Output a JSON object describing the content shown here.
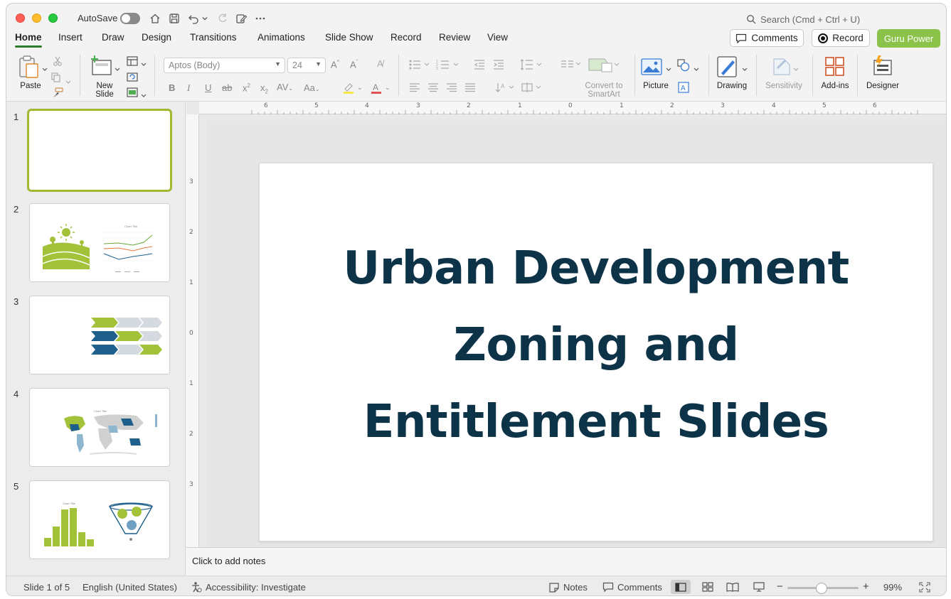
{
  "titlebar": {
    "autosave_label": "AutoSave",
    "search_placeholder": "Search (Cmd + Ctrl + U)"
  },
  "tabs": [
    "Home",
    "Insert",
    "Draw",
    "Design",
    "Transitions",
    "Animations",
    "Slide Show",
    "Record",
    "Review",
    "View"
  ],
  "header_buttons": {
    "comments": "Comments",
    "record": "Record",
    "guru": "Guru Power"
  },
  "ribbon": {
    "paste": "Paste",
    "new_slide": "New\nSlide",
    "font_name": "Aptos (Body)",
    "font_size": "24",
    "convert_smartart": "Convert to\nSmartArt",
    "picture": "Picture",
    "drawing": "Drawing",
    "sensitivity": "Sensitivity",
    "addins": "Add-ins",
    "designer": "Designer"
  },
  "slides": [
    {
      "number": "1"
    },
    {
      "number": "2",
      "thumb_chart_title": "Chart Title"
    },
    {
      "number": "3"
    },
    {
      "number": "4",
      "thumb_chart_title": "Chart Title"
    },
    {
      "number": "5",
      "thumb_chart_title": "Chart Title"
    }
  ],
  "ruler": {
    "h_labels": [
      "6",
      "5",
      "4",
      "3",
      "2",
      "1",
      "0",
      "1",
      "2",
      "3",
      "4",
      "5",
      "6"
    ],
    "v_labels": [
      "3",
      "2",
      "1",
      "0",
      "1",
      "2",
      "3"
    ]
  },
  "slide": {
    "title": "Urban Development\nZoning and\nEntitlement Slides"
  },
  "notes_placeholder": "Click to add notes",
  "status": {
    "slide_of": "Slide 1 of 5",
    "language": "English (United States)",
    "accessibility": "Accessibility: Investigate",
    "notes": "Notes",
    "comments": "Comments",
    "zoom": "99%"
  },
  "colors": {
    "accent_green": "#8bc34a",
    "title_navy": "#0d3349",
    "thumb_green": "#a3c23a",
    "thumb_blue": "#1f5f8b"
  }
}
